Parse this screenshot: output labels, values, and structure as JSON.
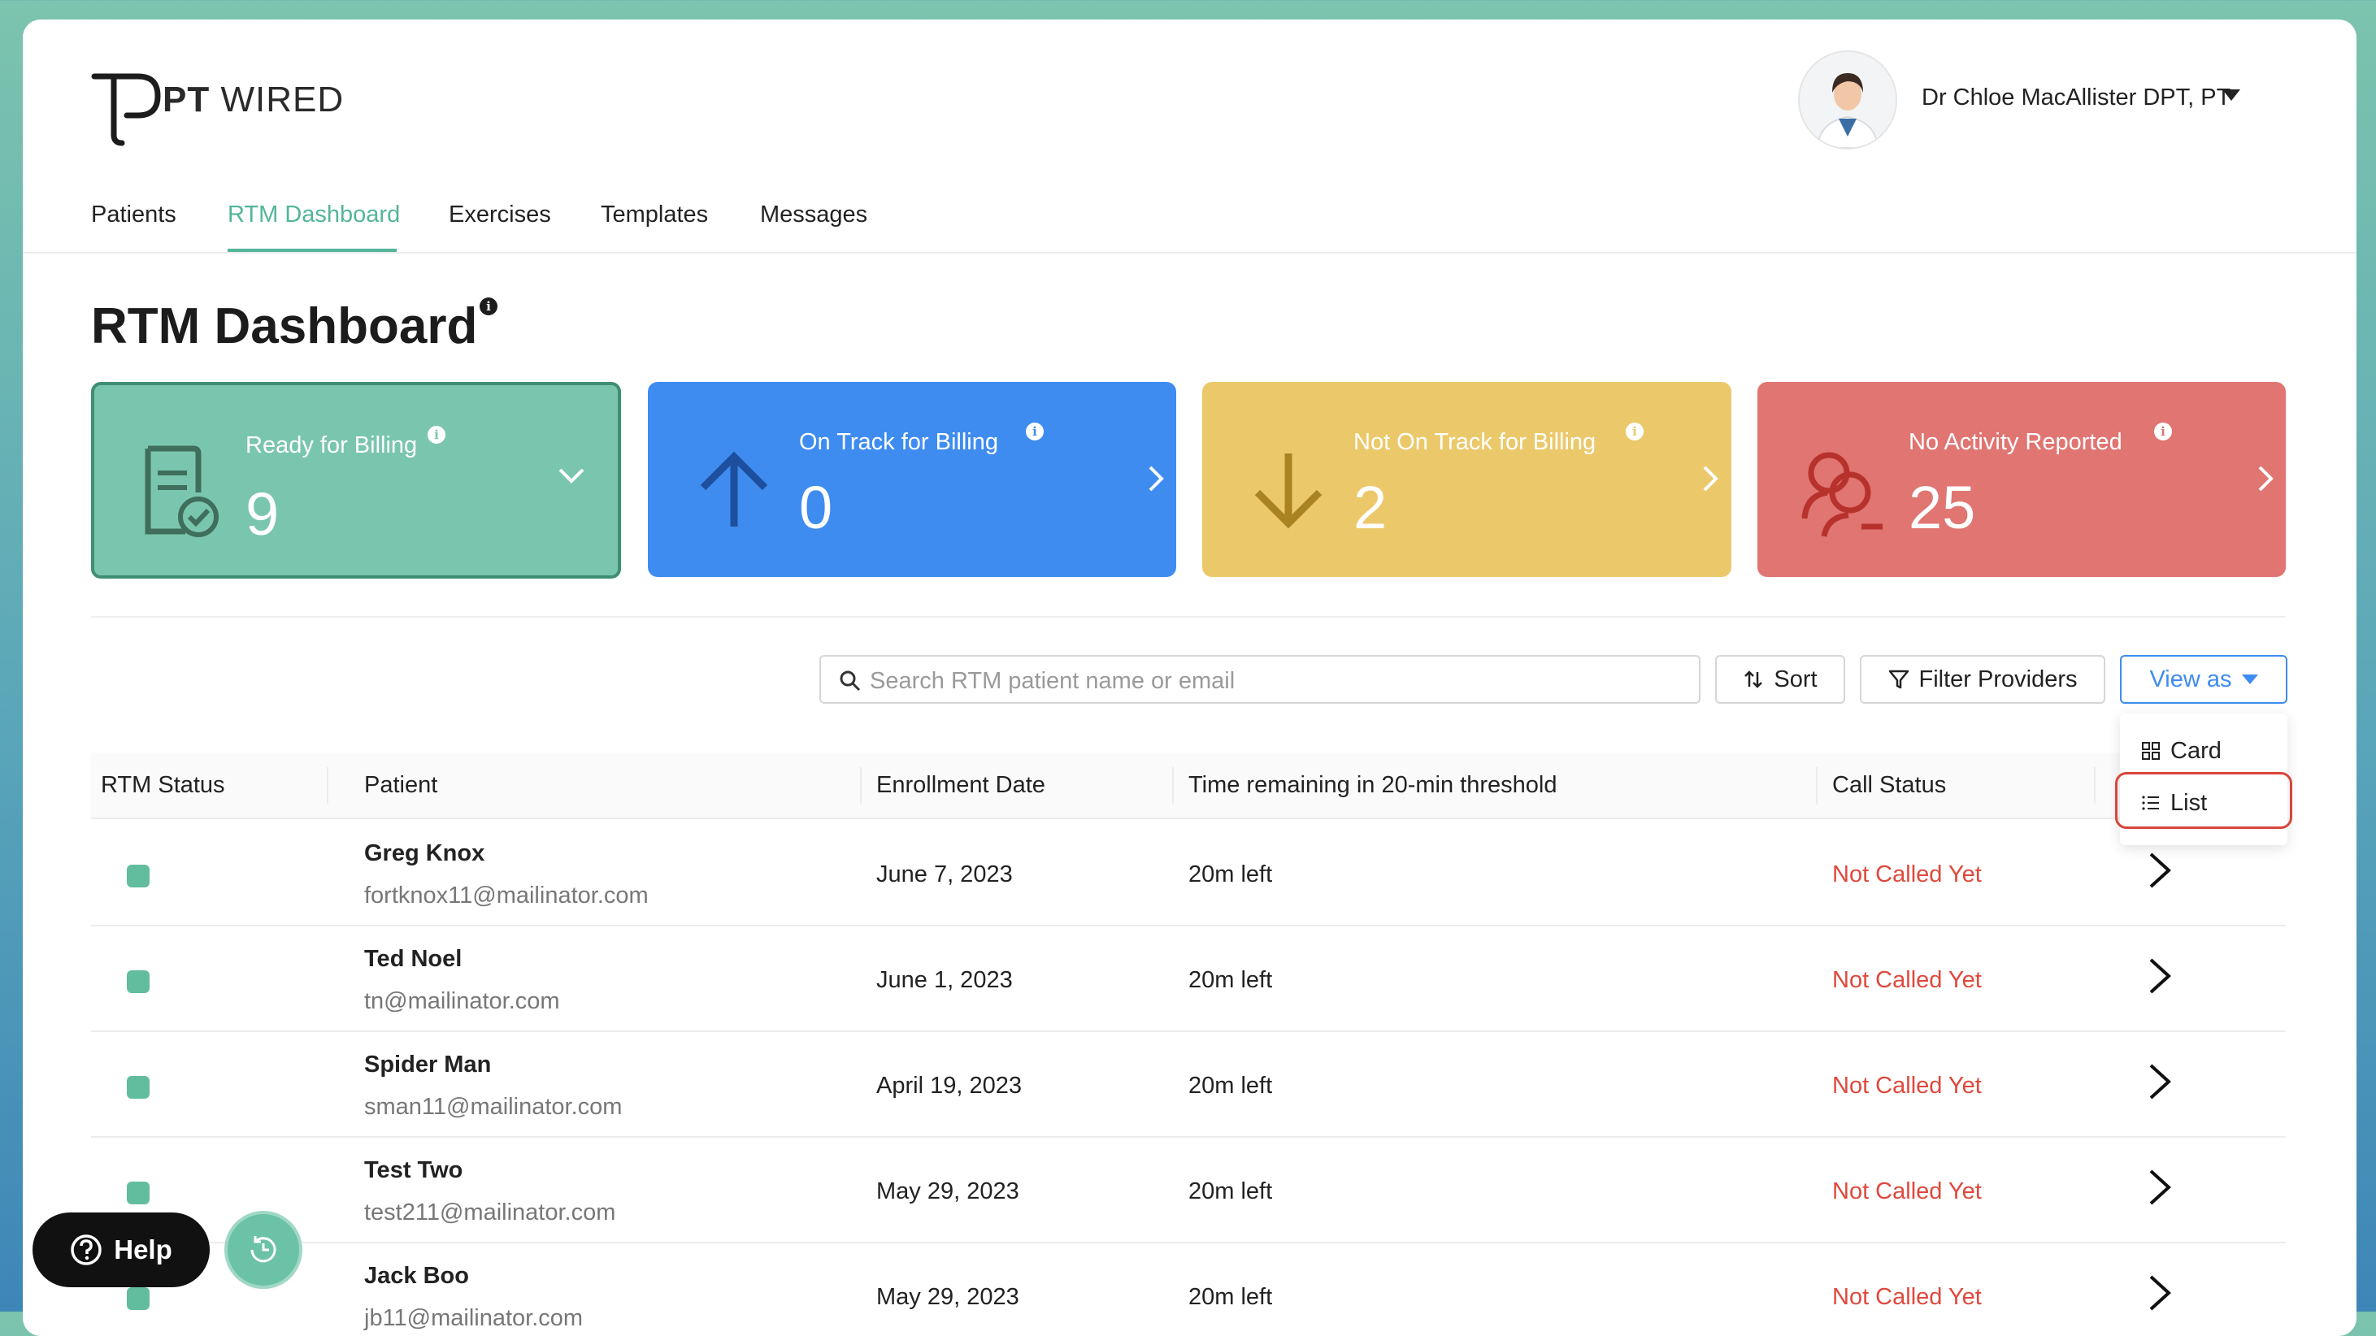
{
  "brand": {
    "name_bold": "PT",
    "name_light": "WIRED"
  },
  "user": {
    "name": "Dr Chloe MacAllister DPT, PT"
  },
  "nav": {
    "items": [
      {
        "label": "Patients"
      },
      {
        "label": "RTM Dashboard",
        "active": true
      },
      {
        "label": "Exercises"
      },
      {
        "label": "Templates"
      },
      {
        "label": "Messages"
      }
    ]
  },
  "page": {
    "title": "RTM Dashboard"
  },
  "stats": [
    {
      "label": "Ready for Billing",
      "value": "9",
      "color": "#7ac5ae"
    },
    {
      "label": "On Track for Billing",
      "value": "0",
      "color": "#3e8cf0"
    },
    {
      "label": "Not On Track for Billing",
      "value": "2",
      "color": "#ebc96b"
    },
    {
      "label": "No Activity Reported",
      "value": "25",
      "color": "#e07572"
    }
  ],
  "toolbar": {
    "search_placeholder": "Search RTM patient name or email",
    "sort_label": "Sort",
    "filter_label": "Filter Providers",
    "view_label": "View as",
    "view_options": [
      "Card",
      "List"
    ],
    "view_selected": "List"
  },
  "table": {
    "columns": [
      "RTM Status",
      "Patient",
      "Enrollment Date",
      "Time remaining in 20-min threshold",
      "Call Status"
    ],
    "rows": [
      {
        "name": "Greg Knox",
        "email": "fortknox11@mailinator.com",
        "date": "June 7, 2023",
        "time": "20m left",
        "call": "Not Called Yet"
      },
      {
        "name": "Ted Noel",
        "email": "tn@mailinator.com",
        "date": "June 1, 2023",
        "time": "20m left",
        "call": "Not Called Yet"
      },
      {
        "name": "Spider Man",
        "email": "sman11@mailinator.com",
        "date": "April 19, 2023",
        "time": "20m left",
        "call": "Not Called Yet"
      },
      {
        "name": "Test Two",
        "email": "test211@mailinator.com",
        "date": "May 29, 2023",
        "time": "20m left",
        "call": "Not Called Yet"
      },
      {
        "name": "Jack Boo",
        "email": "jb11@mailinator.com",
        "date": "May 29, 2023",
        "time": "20m left",
        "call": "Not Called Yet"
      }
    ]
  },
  "help": {
    "label": "Help"
  },
  "colors": {
    "accent": "#53b59b",
    "link_blue": "#3e8cf0",
    "call_red": "#e0483c",
    "status_green": "#62bd9f"
  }
}
